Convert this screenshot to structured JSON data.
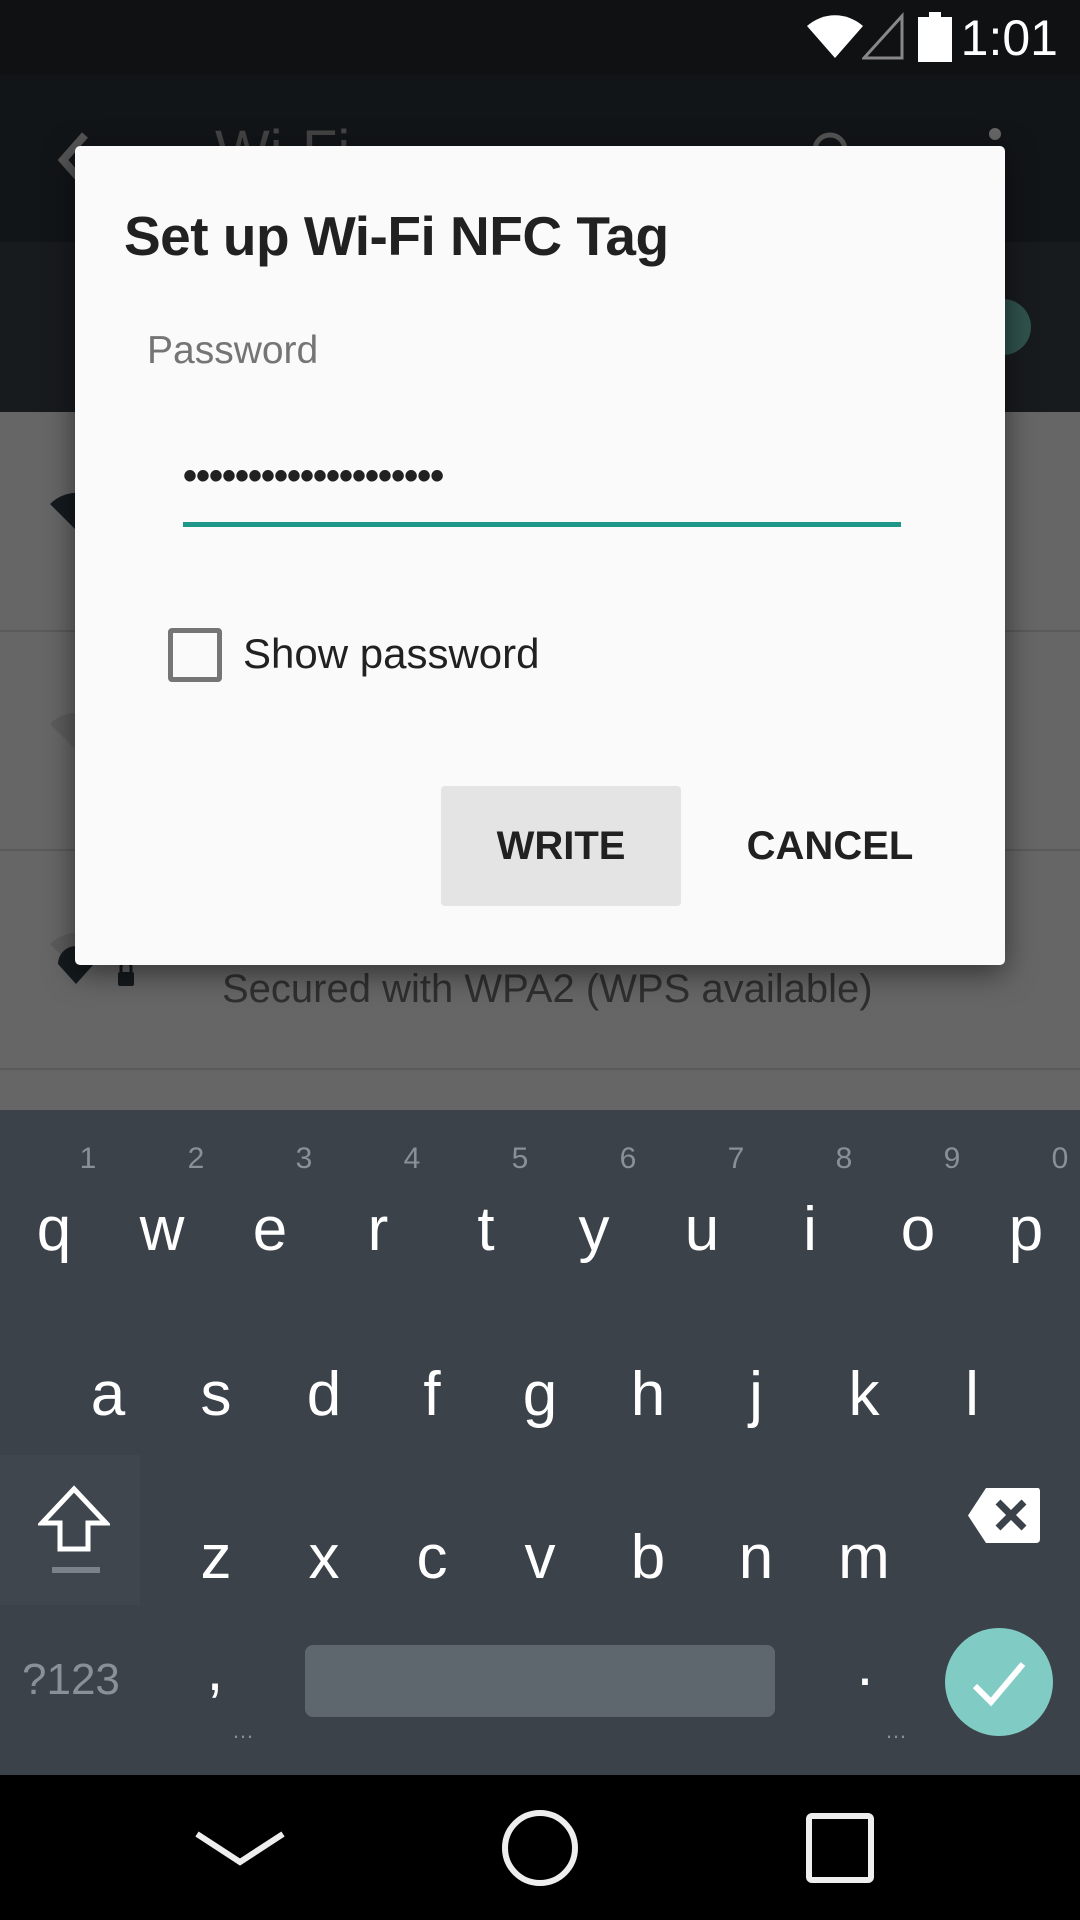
{
  "status_bar": {
    "time": "1:01",
    "icons": [
      "wifi-icon",
      "signal-icon",
      "battery-icon"
    ]
  },
  "background_app": {
    "title": "Wi-Fi",
    "visible_row_subtitle": "Secured with WPA2 (WPS available)"
  },
  "dialog": {
    "title": "Set up Wi-Fi NFC Tag",
    "password_label": "Password",
    "password_value": "••••••••••••••••••••",
    "show_password_label": "Show password",
    "show_password_checked": false,
    "write_label": "WRITE",
    "cancel_label": "CANCEL",
    "accent_color": "#1e9688"
  },
  "keyboard": {
    "row1": [
      "q",
      "w",
      "e",
      "r",
      "t",
      "y",
      "u",
      "i",
      "o",
      "p"
    ],
    "row1_hints": [
      "1",
      "2",
      "3",
      "4",
      "5",
      "6",
      "7",
      "8",
      "9",
      "0"
    ],
    "row2": [
      "a",
      "s",
      "d",
      "f",
      "g",
      "h",
      "j",
      "k",
      "l"
    ],
    "row3": [
      "z",
      "x",
      "c",
      "v",
      "b",
      "n",
      "m"
    ],
    "symbols_label": "?123",
    "comma": ",",
    "period": ".",
    "ellipsis": "…"
  },
  "nav_bar": {
    "buttons": [
      "back-icon",
      "home-icon",
      "recents-icon"
    ]
  }
}
